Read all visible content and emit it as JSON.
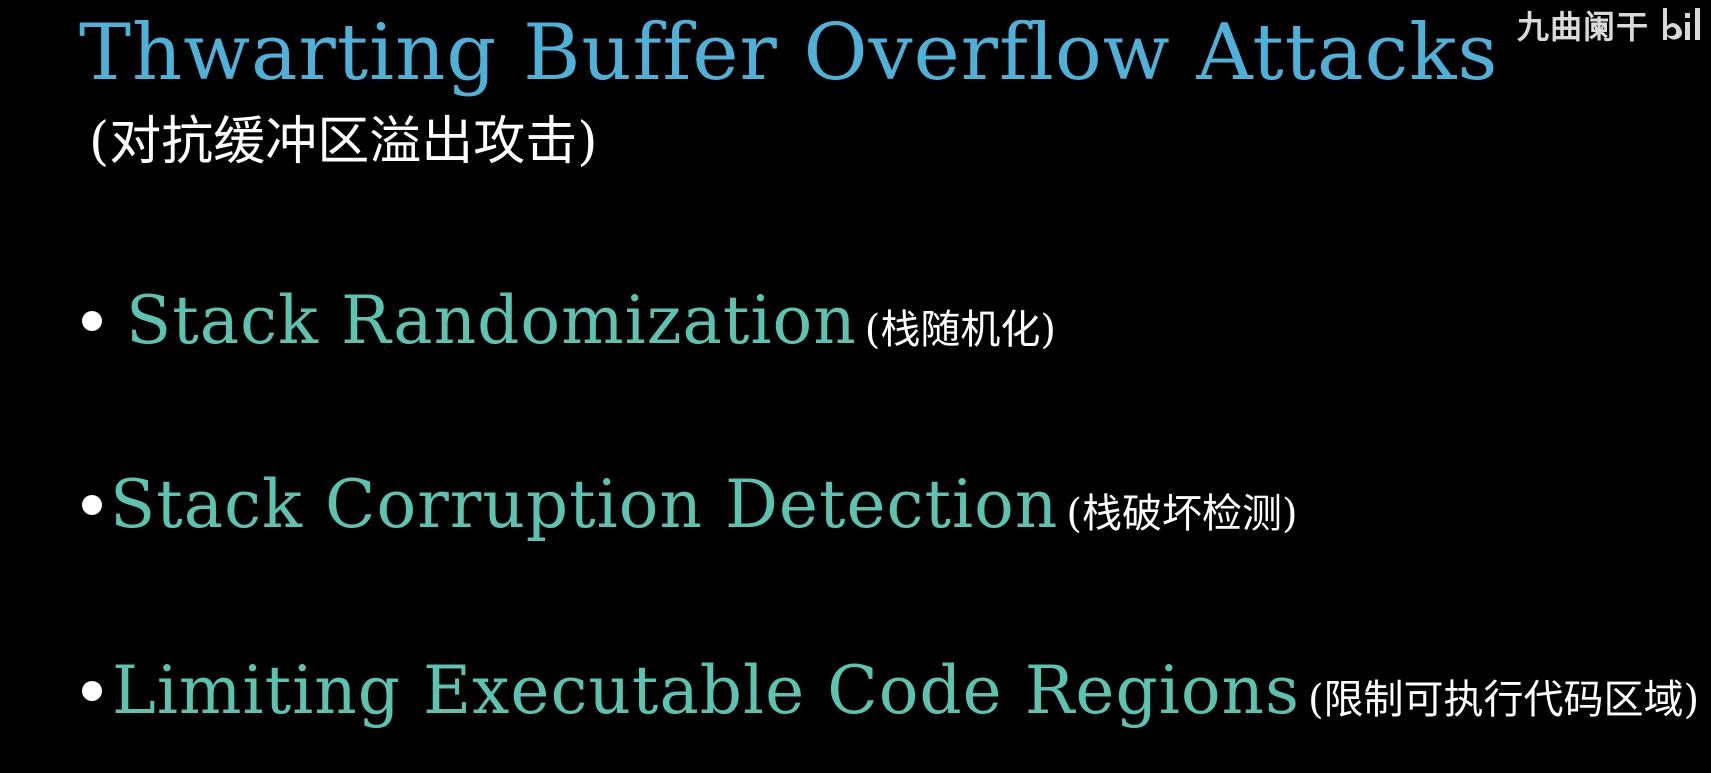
{
  "slide": {
    "title": "Thwarting Buffer Overflow Attacks",
    "subtitle": "(对抗缓冲区溢出攻击)",
    "title_color": "#4fb0d8",
    "bullet_color": "#5cc3b0",
    "background": "#000000"
  },
  "watermark": {
    "text": "九曲阑干",
    "logo_icon": "bilibili-logo-icon"
  },
  "bullets": [
    {
      "text": "Stack Randomization",
      "translation": "(栈随机化)"
    },
    {
      "text": "Stack Corruption Detection",
      "translation": "(栈破坏检测)"
    },
    {
      "text": "Limiting Executable Code Regions",
      "translation": "(限制可执行代码区域)"
    }
  ]
}
